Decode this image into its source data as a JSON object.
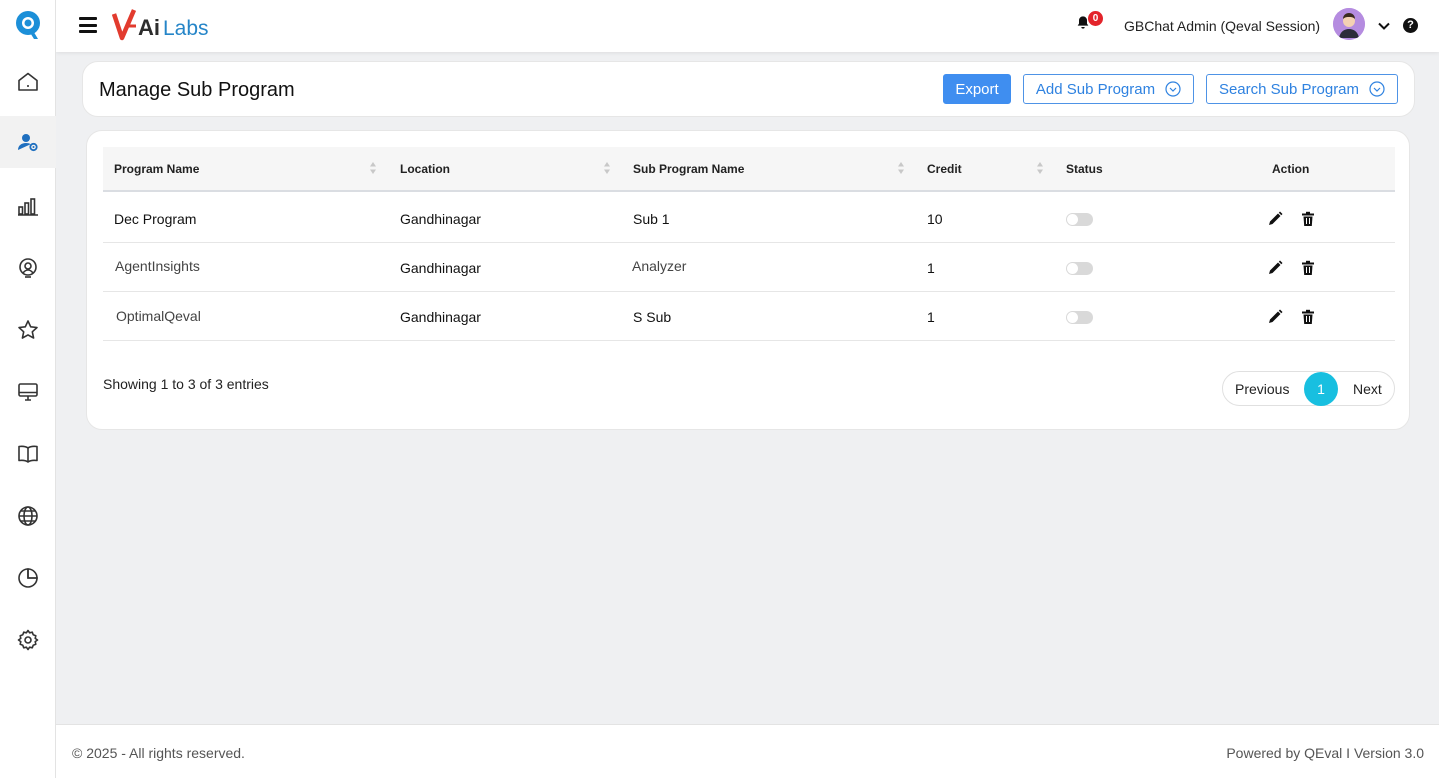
{
  "header": {
    "brand": "V-AiLabs",
    "notification_count": "0",
    "user_name": "GBChat Admin (Qeval Session)",
    "help_label": "?"
  },
  "sidebar": {
    "items": [
      {
        "icon": "home-icon"
      },
      {
        "icon": "user-settings-icon",
        "active": true
      },
      {
        "icon": "bar-chart-icon"
      },
      {
        "icon": "agent-icon"
      },
      {
        "icon": "star-icon"
      },
      {
        "icon": "monitor-icon"
      },
      {
        "icon": "book-icon"
      },
      {
        "icon": "globe-icon"
      },
      {
        "icon": "pie-chart-icon"
      },
      {
        "icon": "gear-icon"
      }
    ]
  },
  "page": {
    "title": "Manage Sub Program",
    "export_label": "Export",
    "add_label": "Add Sub Program",
    "search_label": "Search Sub Program"
  },
  "table": {
    "columns": [
      "Program Name",
      "Location",
      "Sub Program Name",
      "Credit",
      "Status",
      "Action"
    ],
    "rows": [
      {
        "program": "Dec Program",
        "location": "Gandhinagar",
        "sub_program": "Sub 1",
        "credit": "10",
        "status": "off"
      },
      {
        "program": "AgentInsights",
        "location": "Gandhinagar",
        "sub_program": "Analyzer",
        "credit": "1",
        "status": "off"
      },
      {
        "program": "OptimalQeval",
        "location": "Gandhinagar",
        "sub_program": "S Sub",
        "credit": "1",
        "status": "off"
      }
    ],
    "entries_text": "Showing 1 to 3 of 3 entries",
    "pagination": {
      "previous": "Previous",
      "current": "1",
      "next": "Next"
    }
  },
  "footer": {
    "copyright": "© 2025 - All rights reserved.",
    "powered": "Powered by QEval I Version 3.0"
  },
  "colors": {
    "primary": "#3f8ef0",
    "outline": "#2f82e0",
    "pager_active": "#18bfe0",
    "badge": "#e3242b"
  }
}
